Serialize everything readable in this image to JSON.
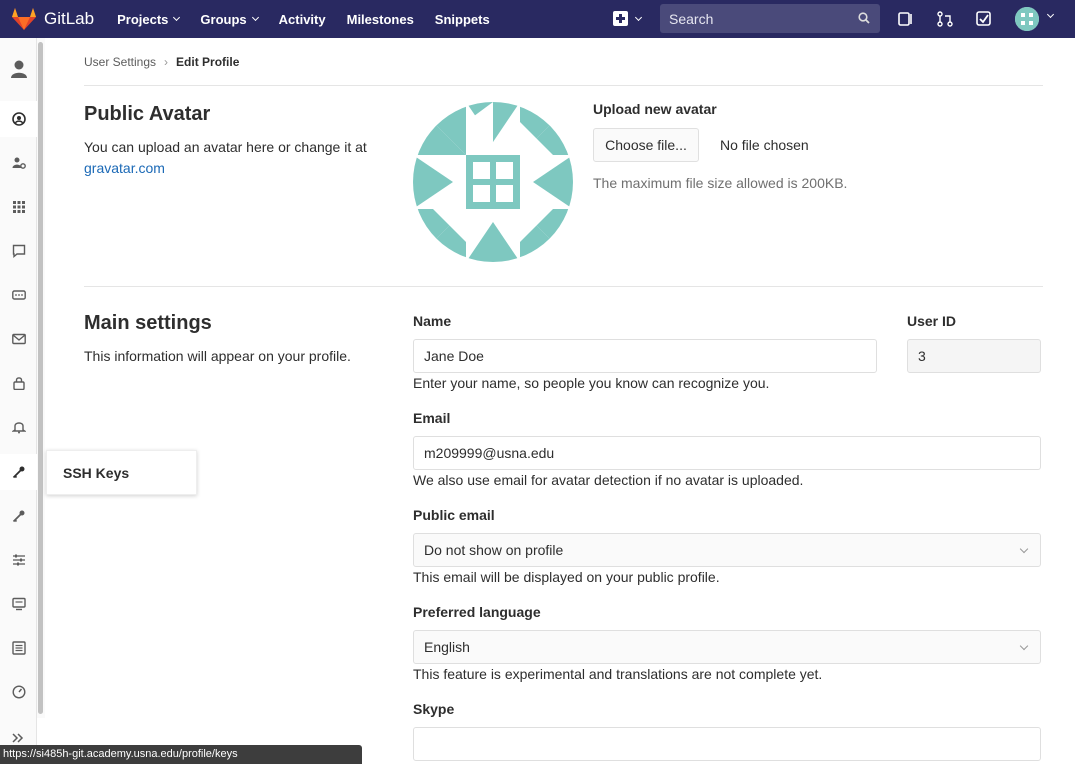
{
  "app": {
    "brand": "GitLab"
  },
  "nav": {
    "links": [
      {
        "label": "Projects",
        "caret": true
      },
      {
        "label": "Groups",
        "caret": true
      },
      {
        "label": "Activity",
        "caret": false
      },
      {
        "label": "Milestones",
        "caret": false
      },
      {
        "label": "Snippets",
        "caret": false
      }
    ],
    "search_placeholder": "Search"
  },
  "sidebar": {
    "items": [
      "profile-icon",
      "account-icon",
      "applications-icon",
      "chat-icon",
      "access-tokens-icon",
      "emails-icon",
      "password-icon",
      "notifications-icon",
      "ssh-keys-icon",
      "gpg-keys-icon",
      "preferences-icon",
      "active-sessions-icon",
      "authentication-log-icon",
      "pipeline-quota-icon"
    ],
    "tooltip": "SSH Keys"
  },
  "breadcrumb": {
    "parent": "User Settings",
    "current": "Edit Profile"
  },
  "avatar_section": {
    "title": "Public Avatar",
    "desc_prefix": "You can upload an avatar here or change it at ",
    "link": "gravatar.com",
    "upload_title": "Upload new avatar",
    "choose_button": "Choose file...",
    "no_file": "No file chosen",
    "help": "The maximum file size allowed is 200KB."
  },
  "main_settings": {
    "title": "Main settings",
    "desc": "This information will appear on your profile.",
    "name_label": "Name",
    "name_value": "Jane Doe",
    "name_help": "Enter your name, so people you know can recognize you.",
    "userid_label": "User ID",
    "userid_value": "3",
    "email_label": "Email",
    "email_value": "m209999@usna.edu",
    "email_help": "We also use email for avatar detection if no avatar is uploaded.",
    "public_email_label": "Public email",
    "public_email_value": "Do not show on profile",
    "public_email_help": "This email will be displayed on your public profile.",
    "language_label": "Preferred language",
    "language_value": "English",
    "language_help": "This feature is experimental and translations are not complete yet.",
    "skype_label": "Skype",
    "skype_value": ""
  },
  "status_url": "https://si485h-git.academy.usna.edu/profile/keys",
  "colors": {
    "nav_bg": "#292961",
    "avatar_teal": "#7ec8c0",
    "link": "#1b69b6"
  }
}
